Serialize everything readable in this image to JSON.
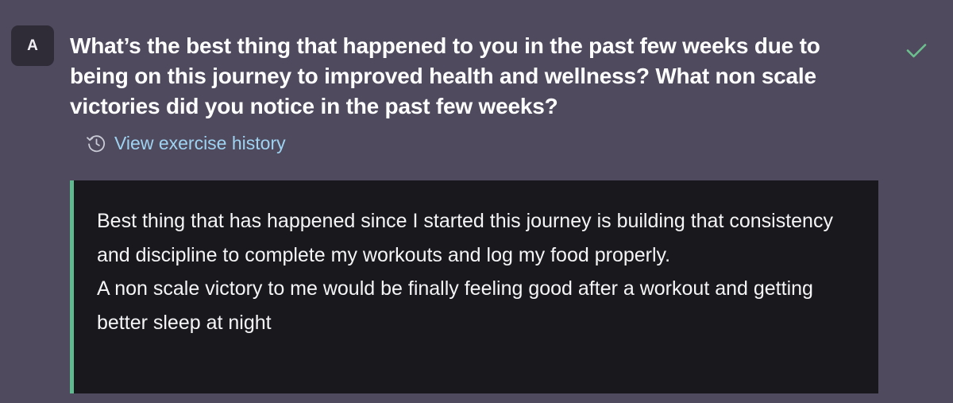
{
  "card": {
    "avatar_letter": "A",
    "question": "What’s the best thing that happened to you in the past few weeks due to being on this journey to improved health and wellness? What non scale victories did you notice in the past few weeks?",
    "completed_icon": "check-icon",
    "history_icon": "history-icon",
    "history_link_label": "View exercise history",
    "answer_line1": "Best thing that has happened since I started this journey is building that consistency and discipline to complete my workouts and log my food properly.",
    "answer_line2": "A non scale victory to me would be finally feeling good after a workout and getting better sleep at night"
  },
  "colors": {
    "background": "#504a5e",
    "avatar_bg": "#2f2b37",
    "answer_bg": "#19181d",
    "accent_border": "#5fba8f",
    "check": "#6cc08f",
    "link": "#9ed3f2"
  }
}
